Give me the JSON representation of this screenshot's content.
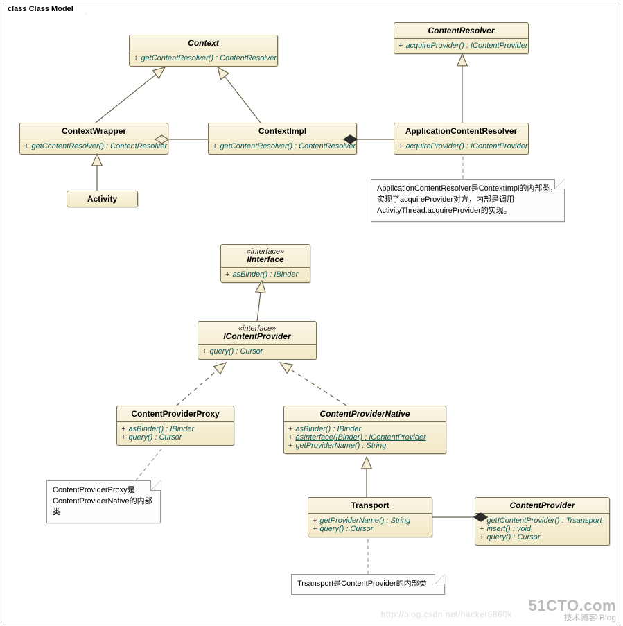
{
  "diagram": {
    "frame_title": "class Class Model",
    "classes": {
      "Context": {
        "name": "Context",
        "members": [
          {
            "vis": "+",
            "sig": "getContentResolver() : ContentResolver"
          }
        ]
      },
      "ContentResolver": {
        "name": "ContentResolver",
        "members": [
          {
            "vis": "+",
            "sig": "acquireProvider() : IContentProvider"
          }
        ]
      },
      "ContextWrapper": {
        "name": "ContextWrapper",
        "members": [
          {
            "vis": "+",
            "sig": "getContentResolver() : ContentResolver"
          }
        ]
      },
      "ContextImpl": {
        "name": "ContextImpl",
        "members": [
          {
            "vis": "+",
            "sig": "getContentResolver() : ContentResolver"
          }
        ]
      },
      "ApplicationContentResolver": {
        "name": "ApplicationContentResolver",
        "members": [
          {
            "vis": "+",
            "sig": "acquireProvider() : IContentProvider"
          }
        ]
      },
      "Activity": {
        "name": "Activity",
        "members": []
      },
      "IInterface": {
        "stereotype": "«interface»",
        "name": "IInterface",
        "members": [
          {
            "vis": "+",
            "sig": "asBinder() : IBinder"
          }
        ]
      },
      "IContentProvider": {
        "stereotype": "«interface»",
        "name": "IContentProvider",
        "members": [
          {
            "vis": "+",
            "sig": "query() : Cursor"
          }
        ]
      },
      "ContentProviderProxy": {
        "name": "ContentProviderProxy",
        "members": [
          {
            "vis": "+",
            "sig": "asBinder() : IBinder"
          },
          {
            "vis": "+",
            "sig": "query() : Cursor"
          }
        ]
      },
      "ContentProviderNative": {
        "name": "ContentProviderNative",
        "members": [
          {
            "vis": "+",
            "sig": "asBinder() : IBinder"
          },
          {
            "vis": "+",
            "sig": "asInterface(IBinder) : IContentProvider",
            "underline": true
          },
          {
            "vis": "+",
            "sig": "getProviderName() : String"
          }
        ]
      },
      "Transport": {
        "name": "Transport",
        "members": [
          {
            "vis": "+",
            "sig": "getProviderName() : String"
          },
          {
            "vis": "+",
            "sig": "query() : Cursor"
          }
        ]
      },
      "ContentProvider": {
        "name": "ContentProvider",
        "members": [
          {
            "vis": "+",
            "sig": "getIContentProvider() : Trsansport"
          },
          {
            "vis": "+",
            "sig": "insert() : void"
          },
          {
            "vis": "+",
            "sig": "query() : Cursor"
          }
        ]
      }
    },
    "notes": {
      "acr_note": "ApplicationContentResolver是ContextImpl的内部类，实现了acquireProvider对方，内部是调用ActivityThread.acquireProvider的实现。",
      "proxy_note": "ContentProviderProxy是ContentProviderNative的内部类",
      "transport_note": "Trsansport是ContentProvider的内部类"
    },
    "relationships": [
      {
        "from": "ContextWrapper",
        "to": "Context",
        "type": "generalization"
      },
      {
        "from": "ContextImpl",
        "to": "Context",
        "type": "generalization"
      },
      {
        "from": "Activity",
        "to": "ContextWrapper",
        "type": "generalization"
      },
      {
        "from": "ApplicationContentResolver",
        "to": "ContentResolver",
        "type": "generalization"
      },
      {
        "from": "ContextWrapper",
        "to": "ContextImpl",
        "type": "aggregation"
      },
      {
        "from": "ContextImpl",
        "to": "ApplicationContentResolver",
        "type": "composition"
      },
      {
        "from": "IContentProvider",
        "to": "IInterface",
        "type": "generalization"
      },
      {
        "from": "ContentProviderProxy",
        "to": "IContentProvider",
        "type": "realization"
      },
      {
        "from": "ContentProviderNative",
        "to": "IContentProvider",
        "type": "realization"
      },
      {
        "from": "Transport",
        "to": "ContentProviderNative",
        "type": "generalization"
      },
      {
        "from": "Transport",
        "to": "ContentProvider",
        "type": "composition"
      },
      {
        "from": "note_acr",
        "to": "ApplicationContentResolver",
        "type": "note-anchor"
      },
      {
        "from": "note_proxy",
        "to": "ContentProviderProxy",
        "type": "note-anchor"
      },
      {
        "from": "note_transport",
        "to": "Transport",
        "type": "note-anchor"
      }
    ]
  },
  "watermark": {
    "line1": "51CTO.com",
    "line2": "技术博客    Blog",
    "url": "http://blog.csdn.net/hacker6860k"
  }
}
